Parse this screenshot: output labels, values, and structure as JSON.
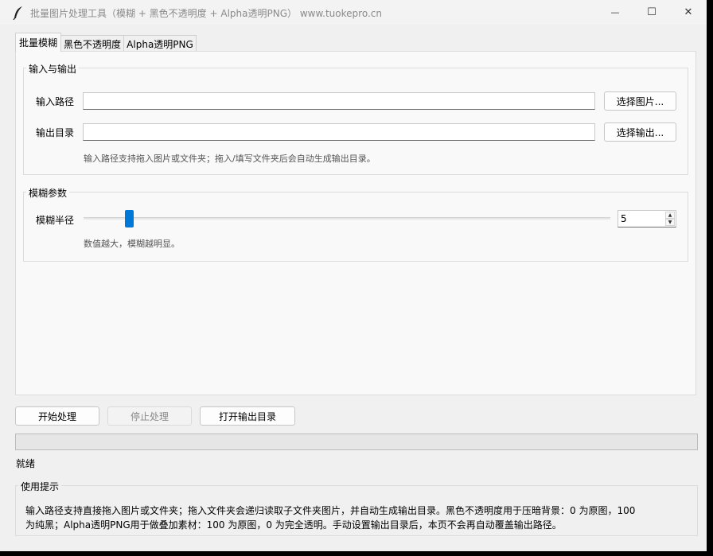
{
  "window": {
    "title": "批量图片处理工具（模糊 + 黑色不透明度 + Alpha透明PNG）   www.tuokepro.cn",
    "controls": {
      "minimize": "—",
      "maximize": "☐",
      "close": "✕"
    }
  },
  "tabs": [
    {
      "label": "批量模糊",
      "active": true
    },
    {
      "label": "黑色不透明度",
      "active": false
    },
    {
      "label": "Alpha透明PNG",
      "active": false
    }
  ],
  "io_group": {
    "title": "输入与输出",
    "input_label": "输入路径",
    "input_value": "",
    "input_button": "选择图片...",
    "output_label": "输出目录",
    "output_value": "",
    "output_button": "选择输出...",
    "hint": "输入路径支持拖入图片或文件夹；拖入/填写文件夹后会自动生成输出目录。"
  },
  "blur_group": {
    "title": "模糊参数",
    "radius_label": "模糊半径",
    "radius_value": "5",
    "radius_fraction": 0.08,
    "hint": "数值越大，模糊越明显。"
  },
  "actions": {
    "start": "开始处理",
    "stop": "停止处理",
    "open_output": "打开输出目录"
  },
  "progress": {
    "value": 0
  },
  "status": "就绪",
  "tips": {
    "title": "使用提示",
    "line1": "输入路径支持直接拖入图片或文件夹；拖入文件夹会递归读取子文件夹图片，并自动生成输出目录。黑色不透明度用于压暗背景：0 为原图，100",
    "line2": "为纯黑；Alpha透明PNG用于做叠加素材：100 为原图，0 为完全透明。手动设置输出目录后，本页不会再自动覆盖输出路径。"
  },
  "colors": {
    "accent": "#0078d7",
    "window_bg": "#f0f0f0",
    "panel_bg": "#f9f9f9"
  }
}
